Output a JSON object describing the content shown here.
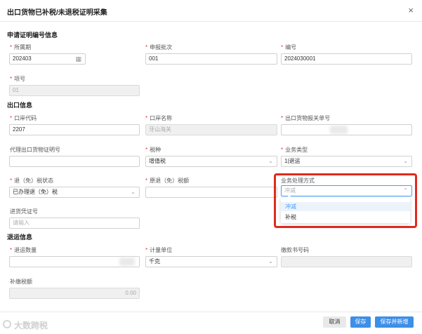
{
  "dialog": {
    "title": "出口货物已补税/未退税证明采集",
    "close_glyph": "×"
  },
  "sections": {
    "apply": "申请证明编号信息",
    "export": "出口信息",
    "refund": "退运信息"
  },
  "fields": {
    "period": {
      "label": "所属期",
      "value": "202403"
    },
    "batch": {
      "label": "申报批次",
      "value": "001"
    },
    "number": {
      "label": "编号",
      "value": "2024030001"
    },
    "item_no": {
      "label": "项号",
      "value": "01"
    },
    "port_code": {
      "label": "口岸代码",
      "value": "2207"
    },
    "port_name": {
      "label": "口岸名称",
      "value": "牙山海关"
    },
    "declaration_no": {
      "label": "出口货物报关单号",
      "value": ""
    },
    "agent_cert_no": {
      "label": "代理出口货物证明号",
      "value": ""
    },
    "tax_type": {
      "label": "税种",
      "value": "增值税"
    },
    "business_type": {
      "label": "业务类型",
      "value": "1|退运"
    },
    "refund_status": {
      "label": "退（免）税状态",
      "value": "已办理退（免）税"
    },
    "orig_refund_amount": {
      "label": "原退（免）税额",
      "value": ""
    },
    "handling_method": {
      "label": "业务处理方式",
      "placeholder": "冲减"
    },
    "import_voucher": {
      "label": "进货凭证号",
      "placeholder": "请输入"
    },
    "return_qty": {
      "label": "退运数量",
      "value": ""
    },
    "unit": {
      "label": "计量单位",
      "value": "千克"
    },
    "receipt_no": {
      "label": "缴款书号码",
      "value": ""
    },
    "supplement_tax": {
      "label": "补缴税额",
      "value": "0.00"
    }
  },
  "dropdown": {
    "options": [
      "冲减",
      "补税"
    ],
    "active_index": 0
  },
  "footer": {
    "cancel": "取消",
    "save": "保存",
    "save_new": "保存并新增"
  },
  "watermark": "大数跨税",
  "colors": {
    "primary": "#3d8fe8",
    "highlight": "#e02a1b",
    "required": "#e53935"
  }
}
